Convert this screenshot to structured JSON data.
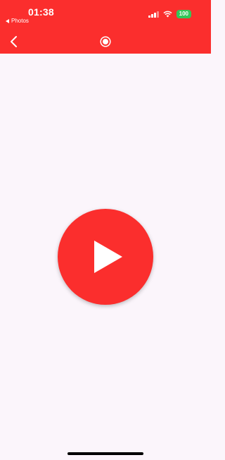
{
  "status_bar": {
    "time": "01:38",
    "back_app_label": "Photos",
    "battery": "100",
    "wifi_icon": "wifi-icon",
    "signal_icon": "cellular-signal-icon"
  },
  "nav": {
    "back_icon": "chevron-left-icon",
    "center_icon": "record-icon"
  },
  "main": {
    "play_icon": "play-icon"
  },
  "colors": {
    "accent": "#fb2e2d",
    "background": "#fbf5fb",
    "battery": "#34c759"
  }
}
